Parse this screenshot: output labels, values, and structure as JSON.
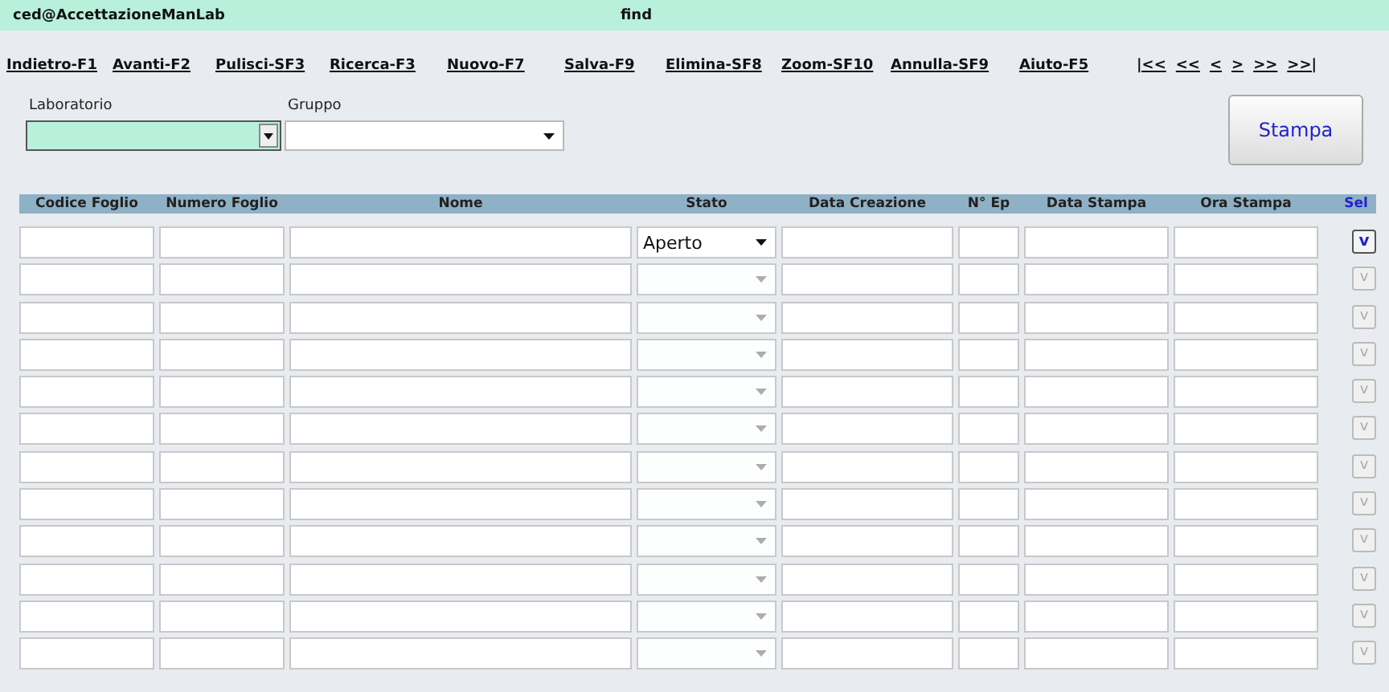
{
  "header": {
    "user": "ced@AccettazioneManLab",
    "mode": "find"
  },
  "toolbar": [
    "Indietro-F1",
    "Avanti-F2",
    "Pulisci-SF3",
    "Ricerca-F3",
    "Nuovo-F7",
    "Salva-F9",
    "Elimina-SF8",
    "Zoom-SF10",
    "Annulla-SF9",
    "Aiuto-F5"
  ],
  "navigation": [
    "|<<",
    "<<",
    "<",
    ">",
    ">>",
    ">>|"
  ],
  "filters": [
    {
      "label": "Laboratorio",
      "focused": true
    },
    {
      "label": "Gruppo",
      "focused": false
    }
  ],
  "print_button": "Stampa",
  "table": {
    "columns": [
      "Codice Foglio",
      "Numero Foglio",
      "Nome",
      "Stato",
      "Data Creazione",
      "N° Ep",
      "Data Stampa",
      "Ora Stampa",
      "Sel"
    ],
    "rows": [
      {
        "enabled": true,
        "stato": "Aperto",
        "sel": "v"
      },
      {
        "enabled": false,
        "sel": "v"
      },
      {
        "enabled": false,
        "sel": "v"
      },
      {
        "enabled": false,
        "sel": "v"
      },
      {
        "enabled": false,
        "sel": "v"
      },
      {
        "enabled": false,
        "sel": "v"
      },
      {
        "enabled": false,
        "sel": "v"
      },
      {
        "enabled": false,
        "sel": "v"
      },
      {
        "enabled": false,
        "sel": "v"
      },
      {
        "enabled": false,
        "sel": "v"
      },
      {
        "enabled": false,
        "sel": "v"
      },
      {
        "enabled": false,
        "sel": "v"
      }
    ]
  }
}
